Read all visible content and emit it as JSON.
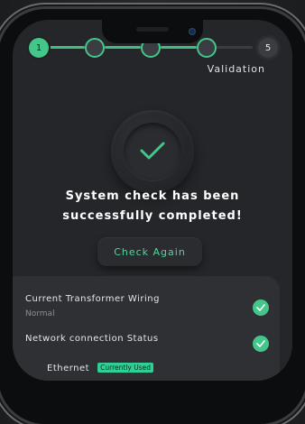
{
  "stepper": {
    "steps": [
      {
        "label": "1",
        "state": "done"
      },
      {
        "label": "",
        "state": "done"
      },
      {
        "label": "",
        "state": "done"
      },
      {
        "label": "",
        "state": "current"
      },
      {
        "label": "5",
        "state": "todo"
      }
    ],
    "current_label": "Validation"
  },
  "status": {
    "message_line1": "System check has been",
    "message_line2": "successfully completed!"
  },
  "actions": {
    "check_again": "Check Again"
  },
  "checks": {
    "items": [
      {
        "title": "Current Transformer Wiring",
        "value": "Normal",
        "ok": true
      },
      {
        "title": "Network connection Status",
        "value": "",
        "ok": true
      }
    ],
    "ethernet": {
      "label": "Ethernet",
      "badge": "Currently Used"
    }
  },
  "colors": {
    "accent": "#44c58a",
    "background": "#242629",
    "card": "#2e3034"
  }
}
